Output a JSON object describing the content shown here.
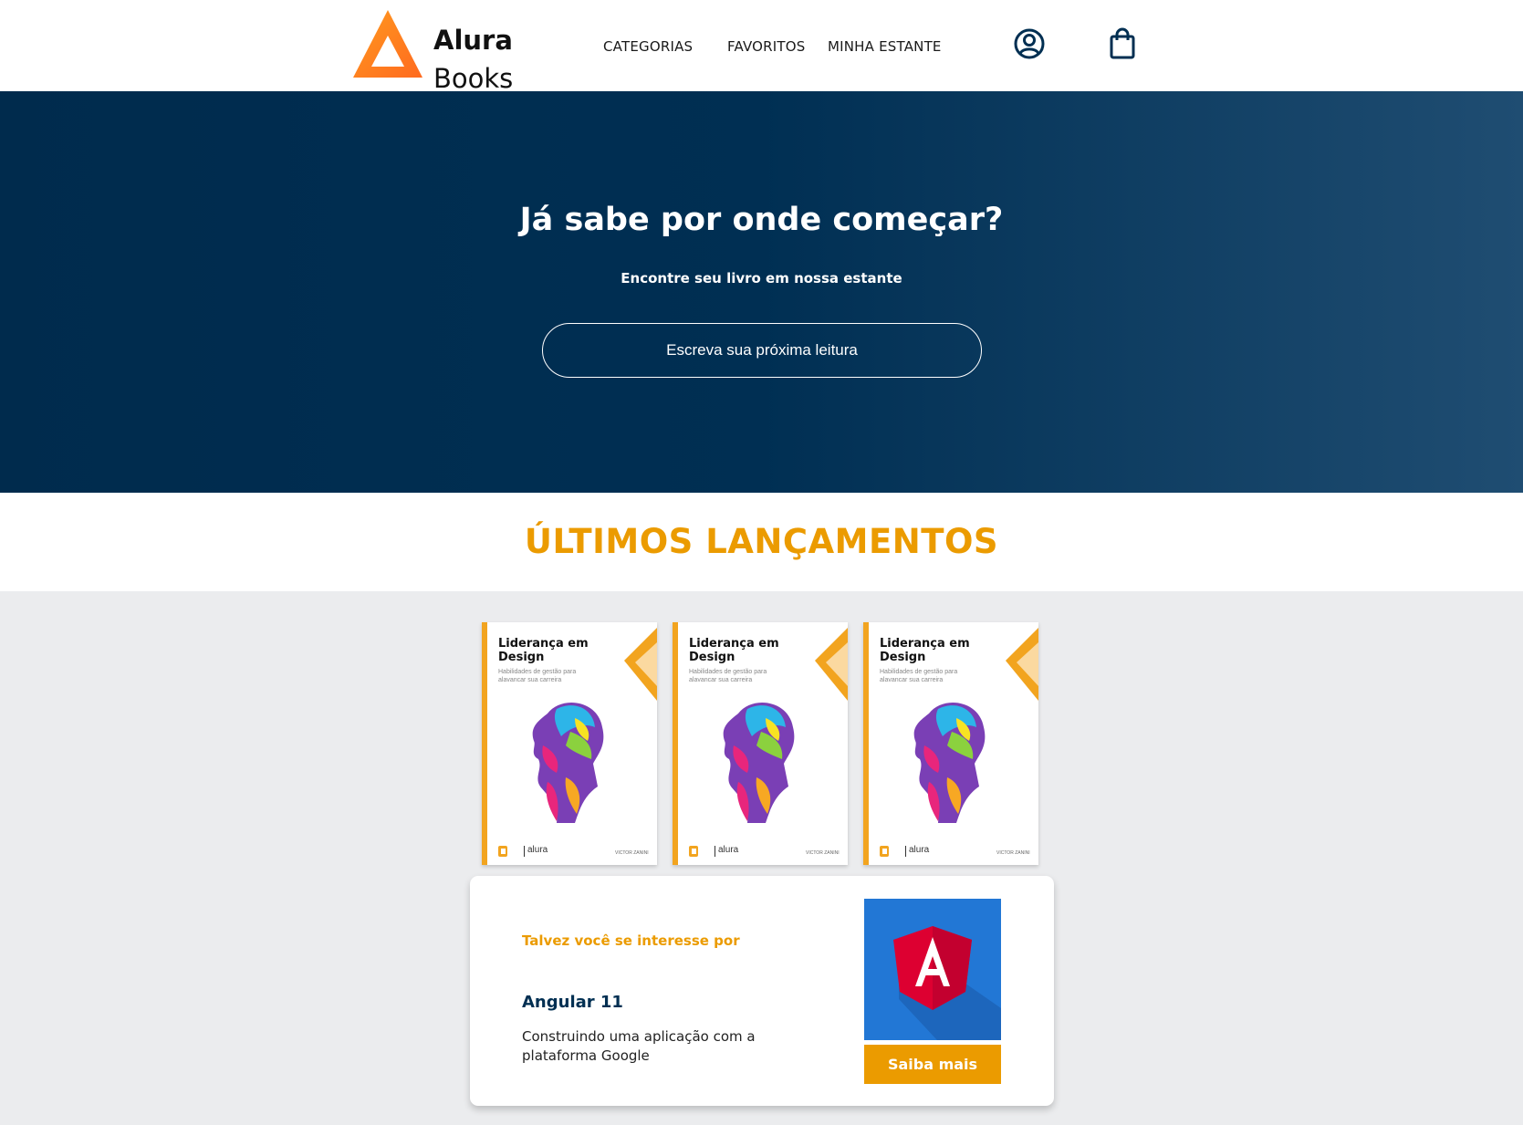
{
  "header": {
    "logo_line1": "Alura",
    "logo_line2": "Books",
    "nav": [
      "CATEGORIAS",
      "FAVORITOS",
      "MINHA ESTANTE"
    ],
    "icons": [
      "user-profile-icon",
      "shopping-bag-icon"
    ]
  },
  "hero": {
    "title": "Já sabe por onde começar?",
    "subtitle": "Encontre seu livro em nossa estante",
    "search_placeholder": "Escreva sua próxima leitura"
  },
  "releases": {
    "title": "ÚLTIMOS LANÇAMENTOS",
    "books": [
      {
        "title": "Liderança em Design",
        "subtitle": "Habilidades de gestão para alavancar sua carreira",
        "publisher": "alura",
        "author": "VICTOR ZANINI"
      },
      {
        "title": "Liderança em Design",
        "subtitle": "Habilidades de gestão para alavancar sua carreira",
        "publisher": "alura",
        "author": "VICTOR ZANINI"
      },
      {
        "title": "Liderança em Design",
        "subtitle": "Habilidades de gestão para alavancar sua carreira",
        "publisher": "alura",
        "author": "VICTOR ZANINI"
      }
    ]
  },
  "recommendation": {
    "label": "Talvez você se interesse por",
    "title": "Angular 11",
    "description": "Construindo uma aplicação com a plataforma Google",
    "button": "Saiba mais"
  },
  "colors": {
    "brand_orange": "#eb9b00",
    "hero_blue": "#002f52",
    "angular_red": "#dd0031",
    "cover_blue": "#2277d5"
  }
}
